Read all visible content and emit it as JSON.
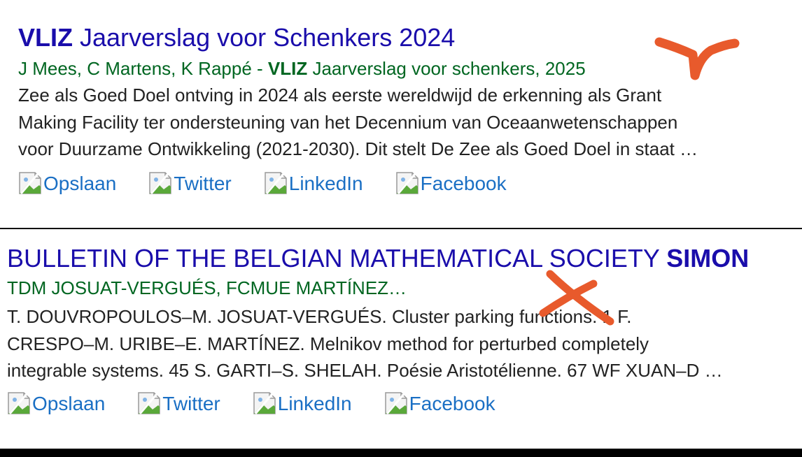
{
  "results": [
    {
      "title_bold": "VLIZ",
      "title_rest": " Jaarverslag voor Schenkers 2024",
      "authors_plain": "J Mees, C Martens, K Rappé - ",
      "authors_bold": "VLIZ",
      "authors_rest": " Jaarverslag voor schenkers, 2025",
      "snippet": [
        "Zee als Goed Doel ontving in 2024 als eerste wereldwijd de erkenning als Grant",
        "Making Facility ter ondersteuning van het Decennium van Oceaanwetenschappen",
        "voor Duurzame Ontwikkeling (2021-2030). Dit stelt De Zee als Goed Doel in staat …"
      ],
      "actions": [
        "Opslaan",
        "Twitter",
        "LinkedIn",
        "Facebook"
      ]
    },
    {
      "title_plain": "BULLETIN OF THE BELGIAN MATHEMATICAL SOCIETY ",
      "title_bold": "SIMON",
      "authors": "TDM JOSUAT-VERGUÉS, FCMUE MARTÍNEZ…",
      "snippet": [
        "T. DOUVROPOULOS–M. JOSUAT-VERGUÉS. Cluster parking functions. 1 F.",
        "CRESPO–M. URIBE–E. MARTÍNEZ. Melnikov method for perturbed completely",
        "integrable systems. 45 S. GARTI–S. SHELAH. Poésie Aristotélienne. 67 WF XUAN–D …"
      ],
      "actions": [
        "Opslaan",
        "Twitter",
        "LinkedIn",
        "Facebook"
      ]
    }
  ],
  "icons": {
    "action_icon": "broken-image-icon"
  },
  "colors": {
    "title": "#1a0dab",
    "authors": "#006621",
    "link": "#1a6fc4",
    "annotation": "#e85a2c"
  }
}
